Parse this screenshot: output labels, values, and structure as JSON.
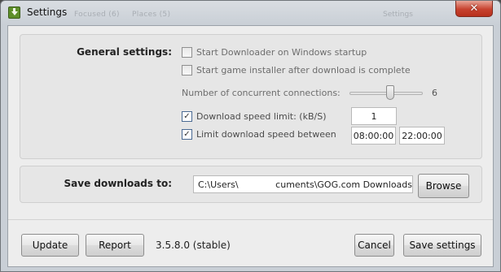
{
  "window": {
    "title": "Settings",
    "ghost_tabs": [
      "Focused (6)",
      "Places (5)"
    ],
    "ghost_right": "Settings",
    "close_glyph": "✕"
  },
  "general": {
    "section_label": "General settings:",
    "start_on_startup": {
      "label": "Start Downloader on Windows startup",
      "checked": false
    },
    "start_installer": {
      "label": "Start game installer after download is complete",
      "checked": false
    },
    "connections": {
      "label": "Number of concurrent connections:",
      "value": "6",
      "slider_fraction": 0.55
    },
    "speed_limit": {
      "label": "Download speed limit: (kB/S)",
      "checked": true,
      "value": "1"
    },
    "limit_between": {
      "label": "Limit download speed between",
      "checked": true,
      "from": "08:00:00",
      "to": "22:00:00"
    },
    "check_glyph": "✓"
  },
  "save": {
    "section_label": "Save downloads to:",
    "path_prefix": "C:\\Users\\",
    "path_suffix": "cuments\\GOG.com Downloads",
    "browse_label": "Browse"
  },
  "footer": {
    "update_label": "Update",
    "report_label": "Report",
    "version": "3.5.8.0 (stable)",
    "cancel_label": "Cancel",
    "save_label": "Save settings"
  },
  "icons": {
    "app_icon": "download-arrow-icon",
    "close": "close-icon",
    "checkbox": "checkmark-icon"
  }
}
